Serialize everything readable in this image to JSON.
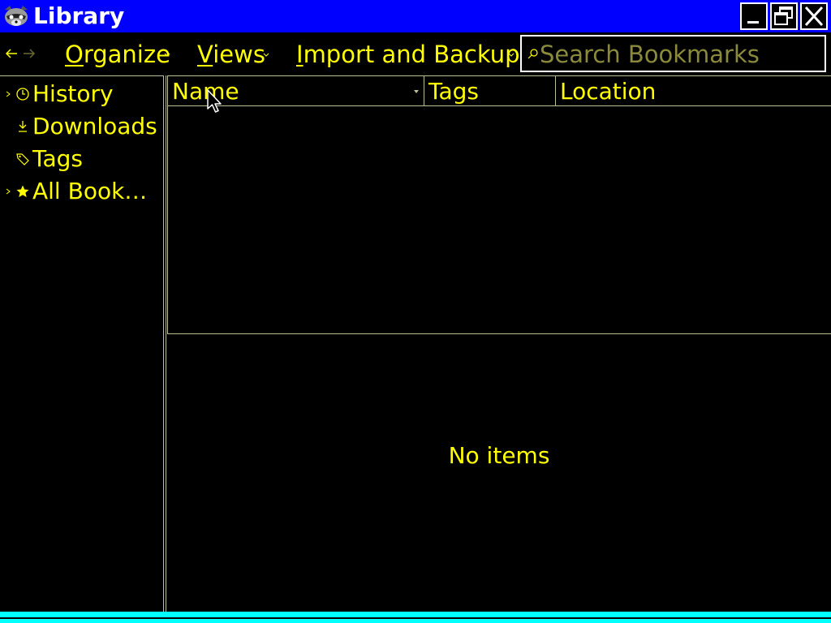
{
  "window": {
    "title": "Library",
    "app_icon": "raccoon-icon",
    "controls": [
      "minimize-icon",
      "restore-icon",
      "close-icon"
    ]
  },
  "toolbar": {
    "back_icon": "arrow-left-icon",
    "forward_icon": "arrow-right-icon",
    "menus": [
      {
        "accesskey": "O",
        "rest": "rganize"
      },
      {
        "accesskey": "V",
        "rest": "iews"
      },
      {
        "accesskey": "I",
        "rest": "mport and Backup"
      }
    ],
    "search": {
      "placeholder": "Search Bookmarks",
      "value": ""
    }
  },
  "sidebar": {
    "items": [
      {
        "label": "History",
        "icon": "clock-icon",
        "expandable": true
      },
      {
        "label": "Downloads",
        "icon": "download-icon",
        "expandable": false
      },
      {
        "label": "Tags",
        "icon": "tag-icon",
        "expandable": false
      },
      {
        "label": "All Book…",
        "icon": "star-icon",
        "expandable": true
      }
    ]
  },
  "table": {
    "columns": [
      "Name",
      "Tags",
      "Location"
    ],
    "rows": []
  },
  "details": {
    "empty_text": "No items"
  },
  "colors": {
    "title_bar": "#0000ff",
    "text": "#ffff00",
    "background": "#000000",
    "placeholder": "#8a8a3a",
    "status_strip": "#00ffff"
  }
}
